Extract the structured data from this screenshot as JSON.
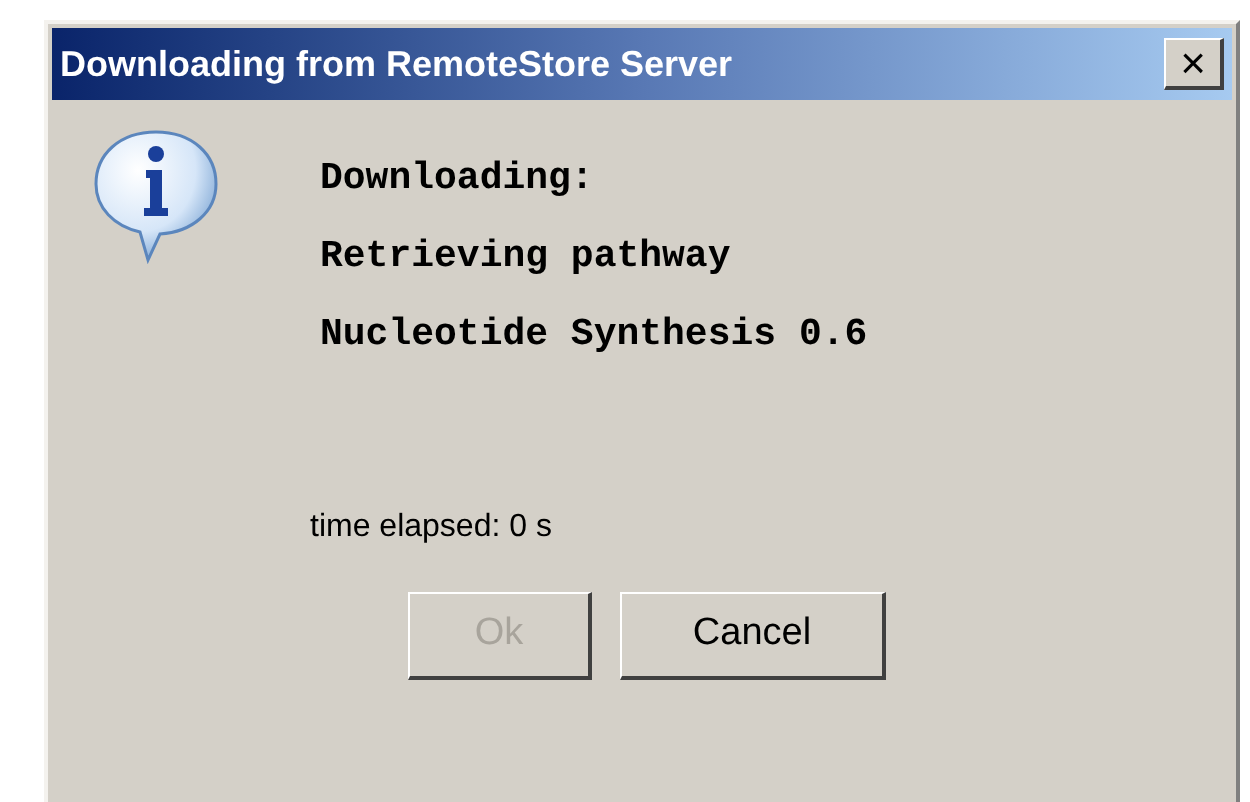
{
  "window": {
    "title": "Downloading from RemoteStore Server",
    "close_button": "×"
  },
  "message": {
    "lines": [
      "Downloading:",
      "Retrieving pathway",
      "Nucleotide Synthesis 0.6"
    ]
  },
  "status": "time elapsed: 0 s",
  "buttons": [
    {
      "label": "Ok",
      "disabled": true
    },
    {
      "label": "Cancel",
      "disabled": false
    }
  ]
}
